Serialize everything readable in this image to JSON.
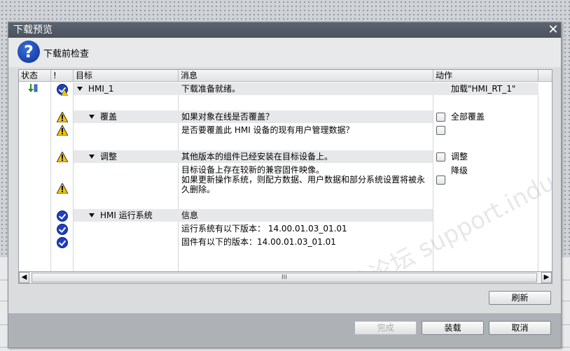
{
  "dialog": {
    "title": "下载预览",
    "close": "✕",
    "header_label": "下载前检查"
  },
  "columns": [
    "状态",
    "!",
    "目标",
    "消息",
    "动作"
  ],
  "rows": [
    {
      "target": "HMI_1",
      "message": "下载准备就绪。",
      "action": "加载\"HMI_RT_1\""
    },
    {
      "target": "覆盖",
      "message": "如果对象在线是否覆盖？",
      "action": "全部覆盖"
    },
    {
      "message": "是否要覆盖此 HMI 设备的现有用户管理数据？"
    },
    {
      "target": "调整",
      "message": "其他版本的组件已经安装在目标设备上。",
      "action": "调整"
    },
    {
      "message_lines": [
        "目标设备上存在较新的兼容固件映像。",
        "如果更新操作系统，则配方数据、用户数据和部分系统设置将被永",
        "久删除。"
      ],
      "action": "降级"
    },
    {
      "target": "HMI 运行系统",
      "message": "信息"
    },
    {
      "message": "运行系统有以下版本： 14.00.01.03_01.01"
    },
    {
      "message": "固件有以下的版本：14.00.01.03_01.01"
    }
  ],
  "buttons": {
    "refresh": "刷新",
    "finish": "完成",
    "load": "装载",
    "cancel": "取消"
  },
  "scroll_thumb": "III",
  "watermark": "西门子工业技术论坛 support.industry.siemens.com/cs",
  "colors": {
    "titlebar": "#4f5863",
    "ok_icon": "#1f3fbf",
    "warning": "#f5c400"
  }
}
